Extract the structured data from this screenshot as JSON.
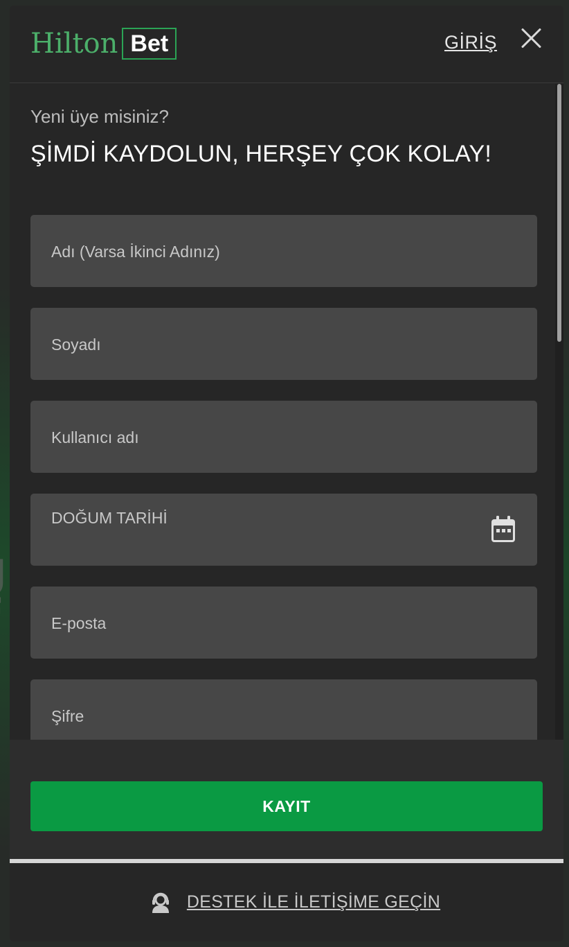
{
  "header": {
    "logo_primary": "Hilton",
    "logo_secondary": "Bet",
    "login_label": "GİRİŞ"
  },
  "form": {
    "subtitle": "Yeni üye misiniz?",
    "title": "ŞİMDİ KAYDOLUN, HERŞEY ÇOK KOLAY!",
    "fields": [
      {
        "label": "Adı (Varsa İkinci Adınız)"
      },
      {
        "label": "Soyadı"
      },
      {
        "label": "Kullanıcı adı"
      },
      {
        "label": "DOĞUM TARİHİ",
        "icon": "calendar-icon"
      },
      {
        "label": "E-posta"
      },
      {
        "label": "Şifre"
      }
    ],
    "submit_label": "KAYIT"
  },
  "footer": {
    "support_label": "DESTEK İLE İLETİŞİME GEÇİN",
    "support_icon": "support-agent-icon"
  },
  "colors": {
    "accent_green": "#0a9a43",
    "logo_green": "#4caf6a",
    "modal_bg": "#262626",
    "field_bg": "#474747"
  }
}
